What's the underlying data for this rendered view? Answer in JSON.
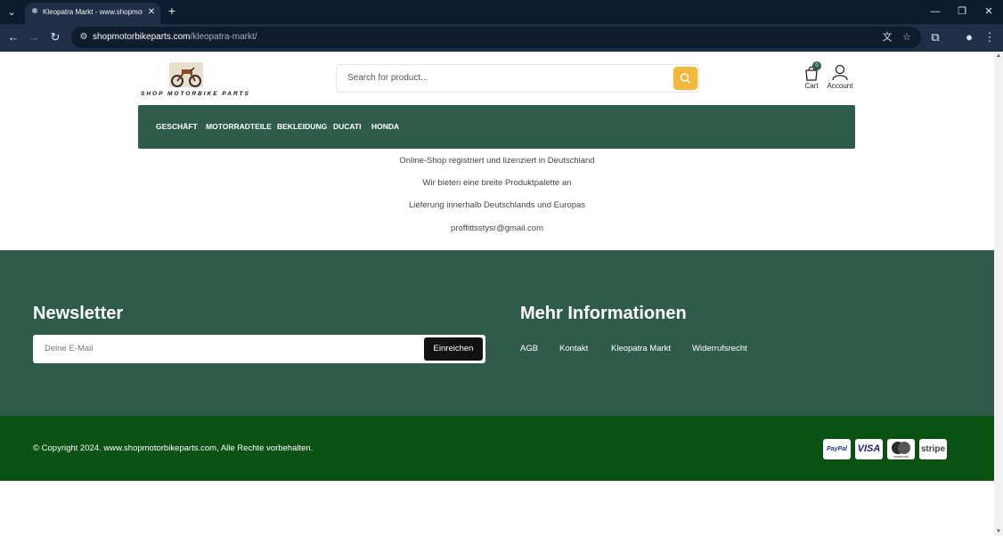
{
  "browser": {
    "tab_title": "Kleopatra Markt - www.shopmotorbikeparts.com",
    "url_domain": "shopmotorbikeparts.com",
    "url_path": "/kleopatra-markt/"
  },
  "header": {
    "logo_text": "SHOP MOTORBIKE PARTS",
    "search_placeholder": "Search for product...",
    "cart_label": "Cart",
    "cart_count": "0",
    "account_label": "Account"
  },
  "nav": {
    "items": [
      "GESCHÄFT",
      "MOTORRADTEILE",
      "BEKLEIDUNG",
      "DUCATI",
      "HONDA"
    ]
  },
  "info": {
    "lines": [
      "Online-Shop registriert und lizenziert in Deutschland",
      "Wir bieten eine breite Produktpalette an",
      "Lieferung innerhalb Deutschlands und Europas",
      "proffittsstysr@gmail.com"
    ]
  },
  "newsletter": {
    "title": "Newsletter",
    "input_placeholder": "Deine E-Mail",
    "submit_label": "Einreichen"
  },
  "more_info": {
    "title": "Mehr Informationen",
    "links": [
      "AGB",
      "Kontakt",
      "Kleopatra Markt",
      "Widerrufsrecht"
    ]
  },
  "footer": {
    "copyright": "© Copyright 2024. www.shopmotorbikeparts.com, Alle Rechte vorbehalten.",
    "payments": [
      "PayPal",
      "VISA",
      "mastercard",
      "stripe"
    ]
  },
  "colors": {
    "nav_green": "#2f5c4a",
    "footer_green": "#0a5213",
    "search_button": "#f2b73b",
    "browser_dark": "#0d1b2e"
  }
}
